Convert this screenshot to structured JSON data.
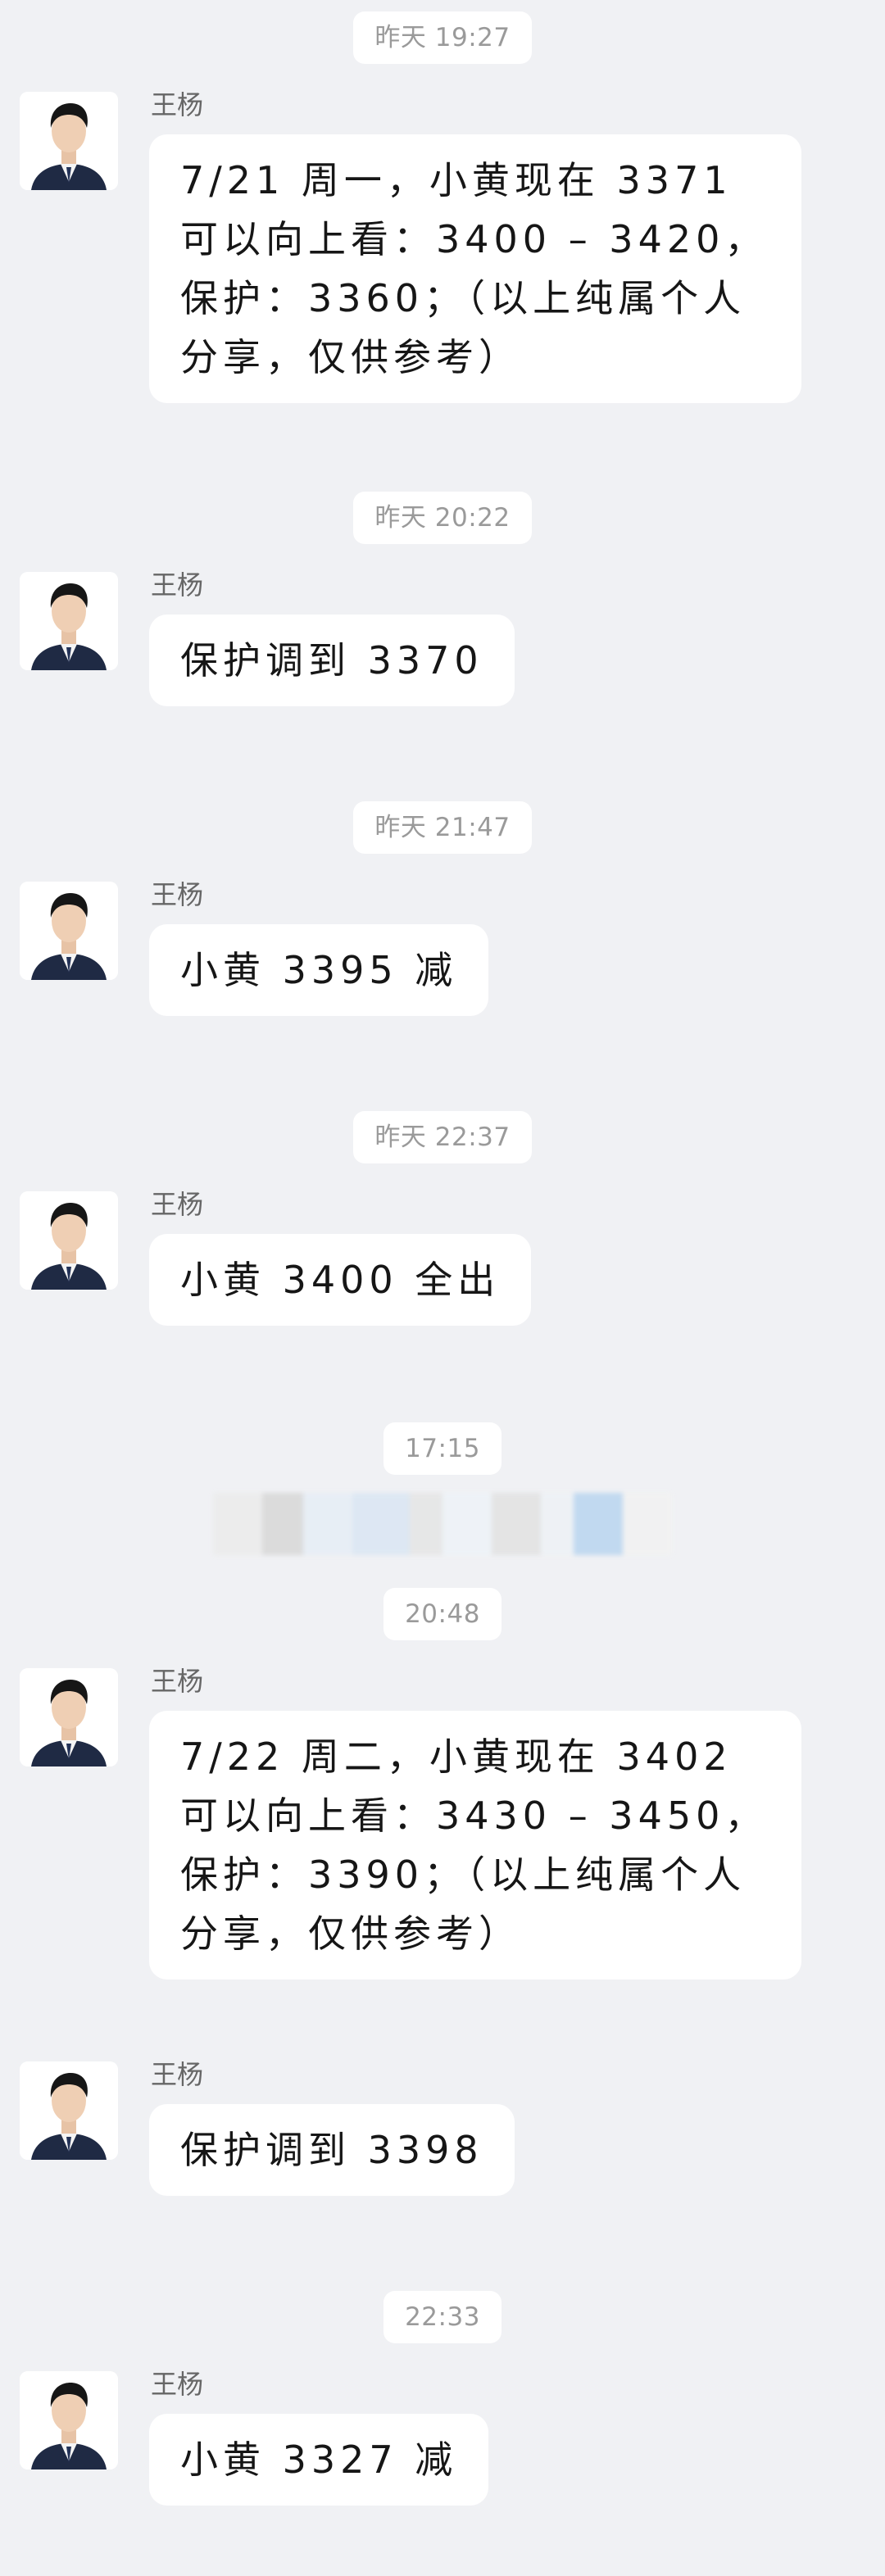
{
  "chat": {
    "timestamps": {
      "t1": "昨天 19:27",
      "t2": "昨天 20:22",
      "t3": "昨天 21:47",
      "t4": "昨天 22:37",
      "t5": "17:15",
      "t6": "20:48",
      "t7": "22:33"
    },
    "messages": [
      {
        "sender": "王杨",
        "text": "7/21 周一，小黄现在 3371 可以向上看：3400 – 3420，保护：3360；（以上纯属个人分享，仅供参考）"
      },
      {
        "sender": "王杨",
        "text": "保护调到 3370"
      },
      {
        "sender": "王杨",
        "text": "小黄 3395 减"
      },
      {
        "sender": "王杨",
        "text": "小黄 3400 全出"
      },
      {
        "sender": "王杨",
        "text": "7/22 周二，小黄现在 3402 可以向上看：3430 – 3450，保护：3390；（以上纯属个人分享，仅供参考）"
      },
      {
        "sender": "王杨",
        "text": "保护调到 3398"
      },
      {
        "sender": "王杨",
        "text": "小黄 3327 减"
      }
    ]
  },
  "colors": {
    "background": "#f0f1f4",
    "bubble": "#ffffff",
    "timestamp_text": "#9a9a9a",
    "sender_text": "#666666"
  },
  "icons": {
    "avatar": "person-portrait"
  }
}
